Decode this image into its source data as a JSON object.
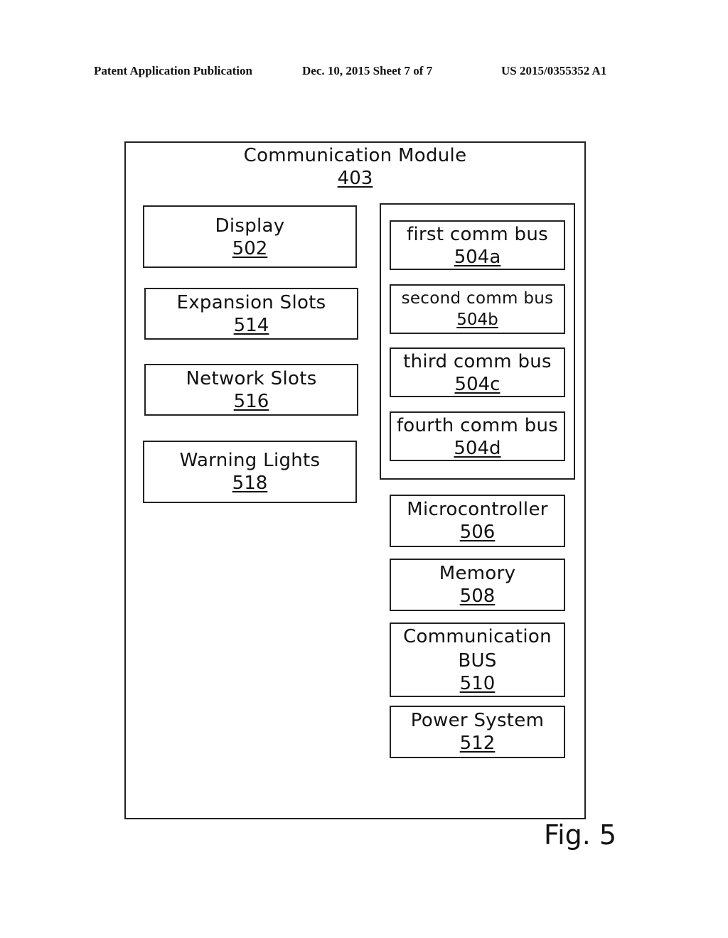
{
  "header": {
    "left": "Patent Application Publication",
    "date_sheet": "Dec. 10, 2015   Sheet 7 of 7",
    "number": "US 2015/0355352 A1"
  },
  "diagram": {
    "outer": {
      "label": "Communication Module",
      "ref": "403"
    },
    "left_column": [
      {
        "label": "Display",
        "ref": "502"
      },
      {
        "label": "Expansion Slots",
        "ref": "514"
      },
      {
        "label": "Network Slots",
        "ref": "516"
      },
      {
        "label": "Warning Lights",
        "ref": "518"
      }
    ],
    "bus_group": [
      {
        "label": "first comm bus",
        "ref": "504a"
      },
      {
        "label": "second comm bus",
        "ref": "504b"
      },
      {
        "label": "third comm bus",
        "ref": "504c"
      },
      {
        "label": "fourth comm bus",
        "ref": "504d"
      }
    ],
    "right_column": [
      {
        "label": "Microcontroller",
        "ref": "506"
      },
      {
        "label": "Memory",
        "ref": "508"
      },
      {
        "label": "Communication BUS",
        "label_lines": [
          "Communication",
          "BUS"
        ],
        "ref": "510"
      },
      {
        "label": "Power System",
        "ref": "512"
      }
    ],
    "figure_label": "Fig. 5"
  }
}
